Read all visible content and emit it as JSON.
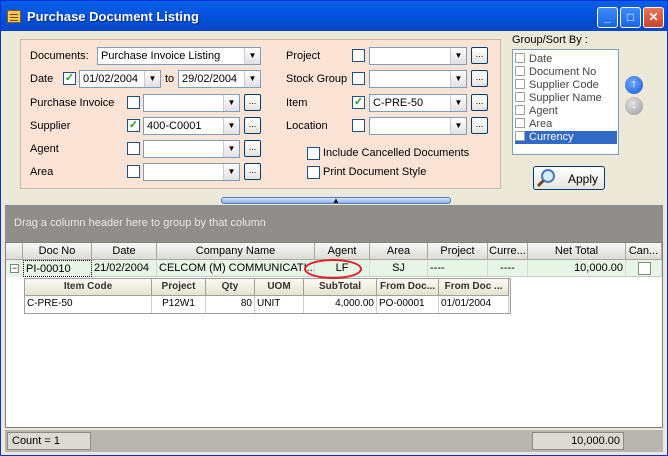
{
  "window": {
    "title": "Purchase Document Listing"
  },
  "filters": {
    "documents_label": "Documents:",
    "documents_value": "Purchase Invoice Listing",
    "date_label": "Date",
    "date_from": "01/02/2004",
    "date_to_label": "to",
    "date_to": "29/02/2004",
    "purchase_invoice_label": "Purchase Invoice",
    "supplier_label": "Supplier",
    "supplier_value": "400-C0001",
    "agent_label": "Agent",
    "area_label": "Area",
    "project_label": "Project",
    "stock_group_label": "Stock Group",
    "item_label": "Item",
    "item_value": "C-PRE-50",
    "location_label": "Location",
    "include_cancelled_label": "Include Cancelled Documents",
    "print_style_label": "Print Document Style",
    "ellipsis": "..."
  },
  "group_sort": {
    "title": "Group/Sort By :",
    "items": [
      "Date",
      "Document No",
      "Supplier Code",
      "Supplier Name",
      "Agent",
      "Area",
      "Currency"
    ],
    "selected": "Currency",
    "apply_label": "Apply"
  },
  "grid": {
    "drag_hint": "Drag a column header here to group by that column",
    "columns": [
      "Doc No",
      "Date",
      "Company Name",
      "Agent",
      "Area",
      "Project",
      "Curre...",
      "Net Total",
      "Can..."
    ],
    "rows": [
      {
        "doc_no": "PI-00010",
        "date": "21/02/2004",
        "company": "CELCOM (M) COMMUNICATI...",
        "agent": "LF",
        "area": "SJ",
        "project": "----",
        "currency": "----",
        "net_total": "10,000.00"
      }
    ],
    "detail_columns": [
      "Item Code",
      "Project",
      "Qty",
      "UOM",
      "SubTotal",
      "From Doc...",
      "From Doc ..."
    ],
    "detail_rows": [
      {
        "item_code": "C-PRE-50",
        "project": "P12W1",
        "qty": "80",
        "uom": "UNIT",
        "subtotal": "4,000.00",
        "from_doc": "PO-00001",
        "from_doc_date": "01/01/2004"
      }
    ]
  },
  "status": {
    "count": "Count = 1",
    "total": "10,000.00"
  }
}
